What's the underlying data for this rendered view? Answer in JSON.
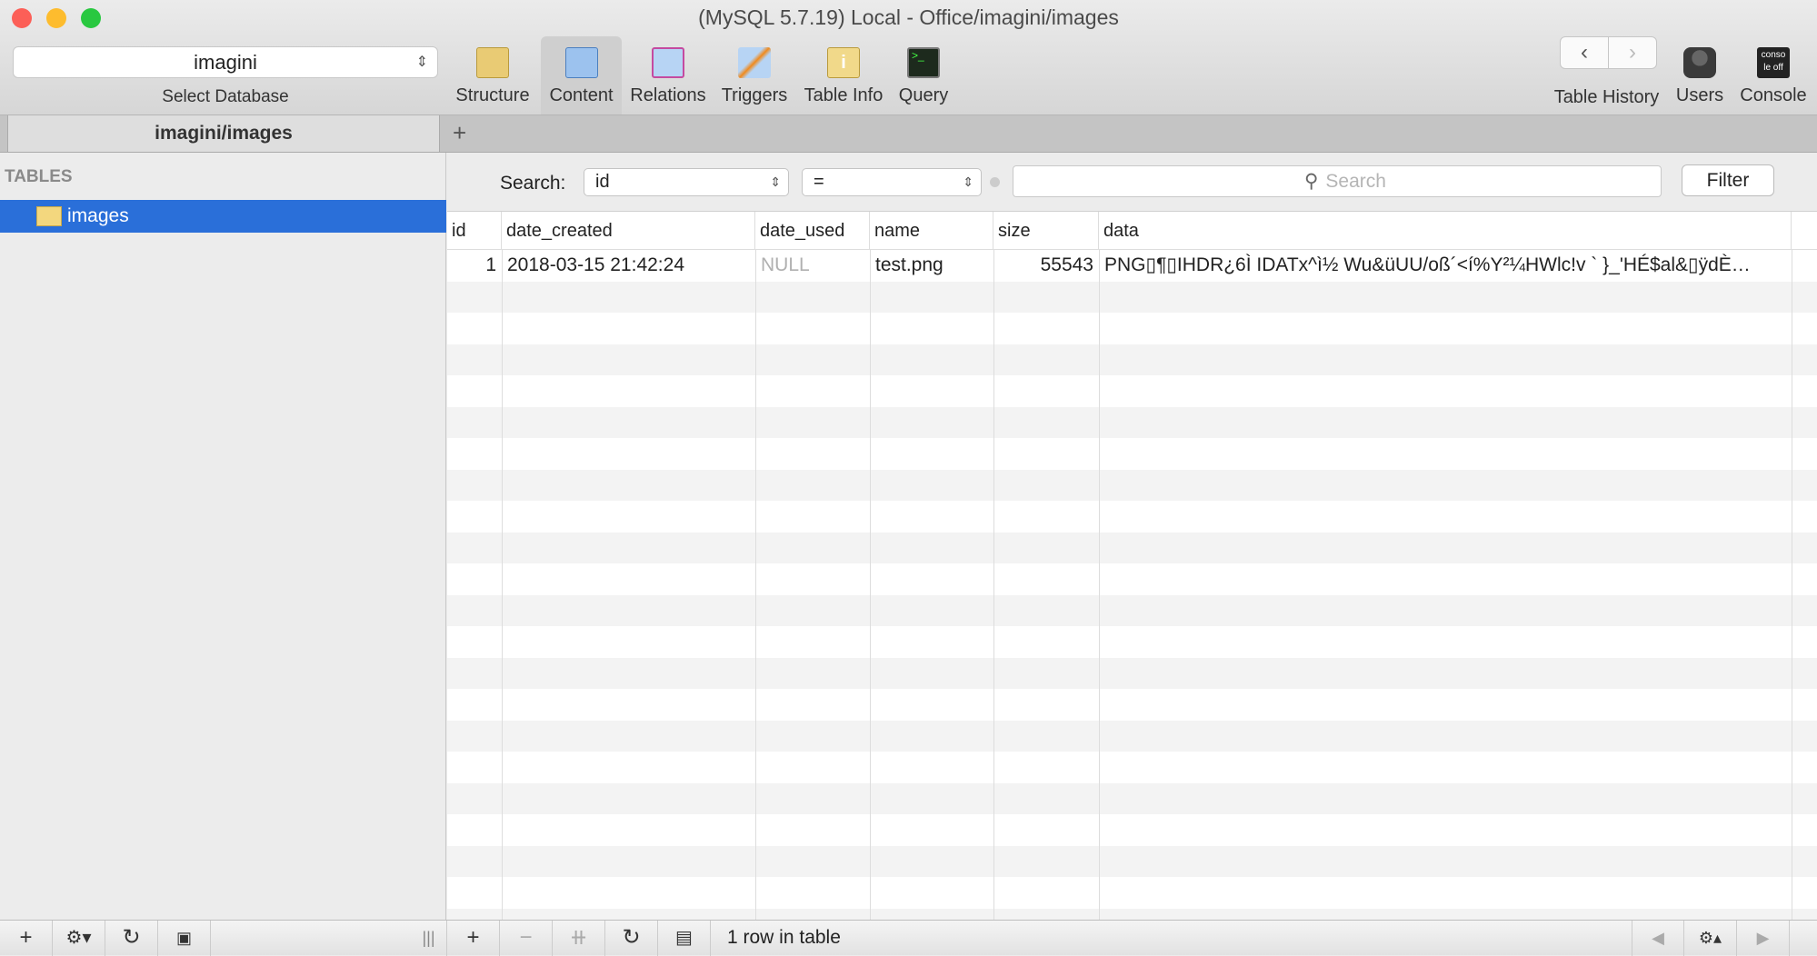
{
  "window": {
    "title": "(MySQL 5.7.19) Local - Office/imagini/images"
  },
  "database": {
    "selected": "imagini",
    "label": "Select Database"
  },
  "toolbar": {
    "items": [
      {
        "label": "Structure",
        "icon": "structure-icon"
      },
      {
        "label": "Content",
        "icon": "content-icon"
      },
      {
        "label": "Relations",
        "icon": "relations-icon"
      },
      {
        "label": "Triggers",
        "icon": "triggers-icon"
      },
      {
        "label": "Table Info",
        "icon": "table-info-icon"
      },
      {
        "label": "Query",
        "icon": "query-icon"
      }
    ],
    "right": {
      "history": "Table History",
      "users": "Users",
      "console": "Console",
      "console_icon_text": "conso le off"
    }
  },
  "tab": {
    "label": "imagini/images",
    "add": "+"
  },
  "sidebar": {
    "heading": "TABLES",
    "tables": [
      "images"
    ]
  },
  "filter": {
    "label": "Search:",
    "field": "id",
    "operator": "=",
    "placeholder": "Search",
    "button": "Filter"
  },
  "table": {
    "columns": [
      "id",
      "date_created",
      "date_used",
      "name",
      "size",
      "data"
    ],
    "rows": [
      [
        "1",
        "2018-03-15 21:42:24",
        "NULL",
        "test.png",
        "55543",
        "PNG▯¶▯IHDR¿6Ì IDATx^ì½ Wu&üUU/oß´<í%Y²¼HWlc!v ` }_'HÉ$al&▯ÿdÈ…"
      ]
    ]
  },
  "status": {
    "text": "1 row in table"
  },
  "colors": {
    "selection": "#2a6fd9",
    "null": "#b0b0b0"
  }
}
